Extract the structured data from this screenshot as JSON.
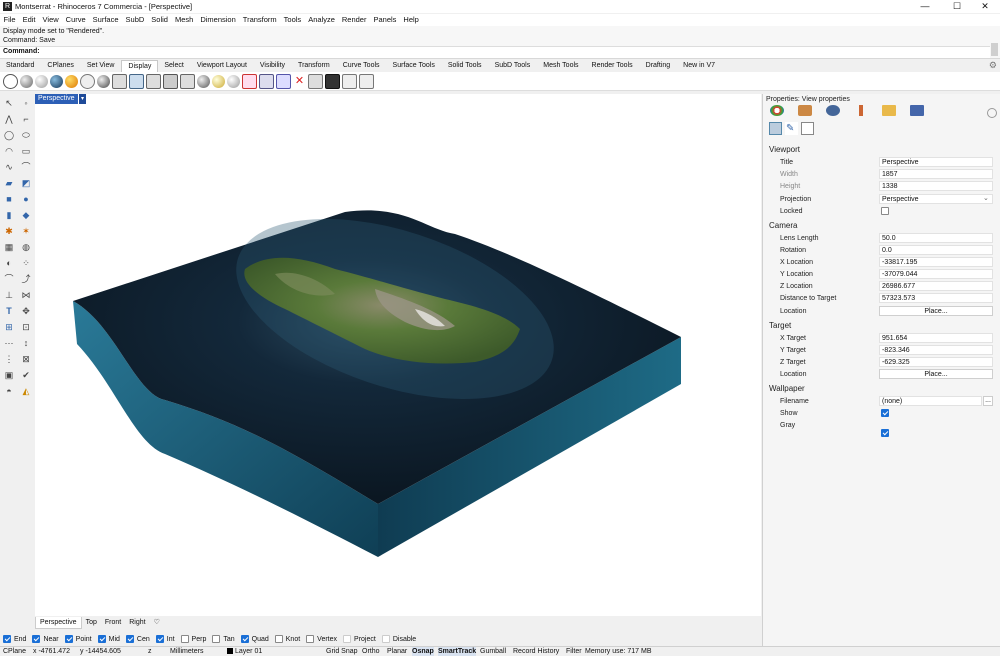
{
  "window": {
    "title": "Montserrat - Rhinoceros 7 Commercia - [Perspective]",
    "minimize": "—",
    "maximize": "☐",
    "close": "✕"
  },
  "menu": [
    "File",
    "Edit",
    "View",
    "Curve",
    "Surface",
    "SubD",
    "Solid",
    "Mesh",
    "Dimension",
    "Transform",
    "Tools",
    "Analyze",
    "Render",
    "Panels",
    "Help"
  ],
  "command": {
    "history_1": "Display mode set to \"Rendered\".",
    "history_2": "Command: Save",
    "prompt": "Command:"
  },
  "toolbar_tabs": [
    "Standard",
    "CPlanes",
    "Set View",
    "Display",
    "Select",
    "Viewport Layout",
    "Visibility",
    "Transform",
    "Curve Tools",
    "Surface Tools",
    "Solid Tools",
    "SubD Tools",
    "Mesh Tools",
    "Render Tools",
    "Drafting",
    "New in V7"
  ],
  "active_toolbar_tab": "Display",
  "viewport": {
    "title": "Perspective",
    "dropdown": "▾"
  },
  "viewport_tabs": [
    "Perspective",
    "Top",
    "Front",
    "Right"
  ],
  "viewport_tab_add": "♡",
  "osnaps": [
    {
      "label": "End",
      "on": true
    },
    {
      "label": "Near",
      "on": true
    },
    {
      "label": "Point",
      "on": true
    },
    {
      "label": "Mid",
      "on": true
    },
    {
      "label": "Cen",
      "on": true
    },
    {
      "label": "Int",
      "on": true
    },
    {
      "label": "Perp",
      "on": false
    },
    {
      "label": "Tan",
      "on": false
    },
    {
      "label": "Quad",
      "on": true
    },
    {
      "label": "Knot",
      "on": false
    },
    {
      "label": "Vertex",
      "on": false
    },
    {
      "label": "Project",
      "on": false
    },
    {
      "label": "Disable",
      "on": false
    }
  ],
  "status": {
    "cplane": "CPlane",
    "x": "x -4761.472",
    "y": "y -14454.605",
    "z": "z",
    "units": "Millimeters",
    "layer": "Layer 01",
    "grid_snap": "Grid Snap",
    "ortho": "Ortho",
    "planar": "Planar",
    "osnap": "Osnap",
    "smarttrack": "SmartTrack",
    "gumball": "Gumball",
    "record_history": "Record History",
    "filter": "Filter",
    "memory": "Memory use: 717 MB"
  },
  "properties": {
    "header": "Properties: View properties",
    "sections": {
      "viewport": "Viewport",
      "camera": "Camera",
      "target": "Target",
      "wallpaper": "Wallpaper"
    },
    "viewport_fields": {
      "title_label": "Title",
      "title": "Perspective",
      "width_label": "Width",
      "width": "1857",
      "height_label": "Height",
      "height": "1338",
      "projection_label": "Projection",
      "projection": "Perspective",
      "locked_label": "Locked"
    },
    "camera_fields": {
      "lens_label": "Lens Length",
      "lens": "50.0",
      "rotation_label": "Rotation",
      "rotation": "0.0",
      "xloc_label": "X Location",
      "xloc": "-33817.195",
      "yloc_label": "Y Location",
      "yloc": "-37079.044",
      "zloc_label": "Z Location",
      "zloc": "26986.677",
      "dist_label": "Distance to Target",
      "dist": "57323.573",
      "location_label": "Location",
      "place": "Place..."
    },
    "target_fields": {
      "x_label": "X Target",
      "x": "951.654",
      "y_label": "Y Target",
      "y": "-823.346",
      "z_label": "Z Target",
      "z": "-629.325",
      "location_label": "Location",
      "place": "Place..."
    },
    "wallpaper_fields": {
      "filename_label": "Filename",
      "filename": "(none)",
      "browse": "...",
      "show_label": "Show",
      "gray_label": "Gray"
    }
  }
}
